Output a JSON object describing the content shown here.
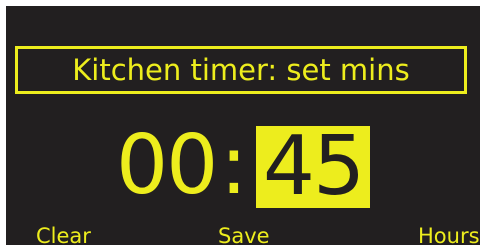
{
  "screen": {
    "title": "Kitchen timer: set mins",
    "time": {
      "hours": "00",
      "separator": ":",
      "minutes": "45",
      "selected_field": "minutes"
    },
    "softkeys": {
      "left": "Clear",
      "center": "Save",
      "right": "Hours"
    }
  },
  "colors": {
    "background": "#221f20",
    "accent": "#eded1d"
  }
}
